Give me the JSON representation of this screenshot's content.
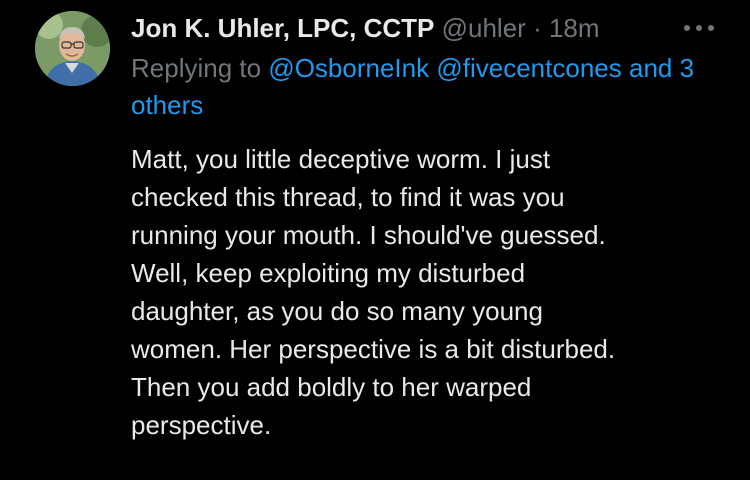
{
  "tweet": {
    "display_name": "Jon K. Uhler, LPC, CCTP",
    "handle": "@uhler",
    "separator": "·",
    "time": "18m",
    "avatar_icon": "avatar-photo",
    "more_icon": "more-options-icon",
    "replying": {
      "prefix": "Replying to",
      "mentions": [
        "@OsborneInk",
        "@fivecentcones"
      ],
      "others": "and 3 others"
    },
    "body_lines": [
      "Matt, you little deceptive worm. I just",
      "checked this thread, to find it was you",
      "running your mouth. I should've guessed.",
      "Well, keep exploiting my disturbed",
      "daughter, as you do so many young",
      "women. Her perspective is a bit disturbed.",
      "Then you add boldly to her warped",
      "perspective."
    ]
  },
  "colors": {
    "background": "#000000",
    "text_primary": "#e7e9ea",
    "text_secondary": "#71767b",
    "link": "#1d9bf0"
  }
}
